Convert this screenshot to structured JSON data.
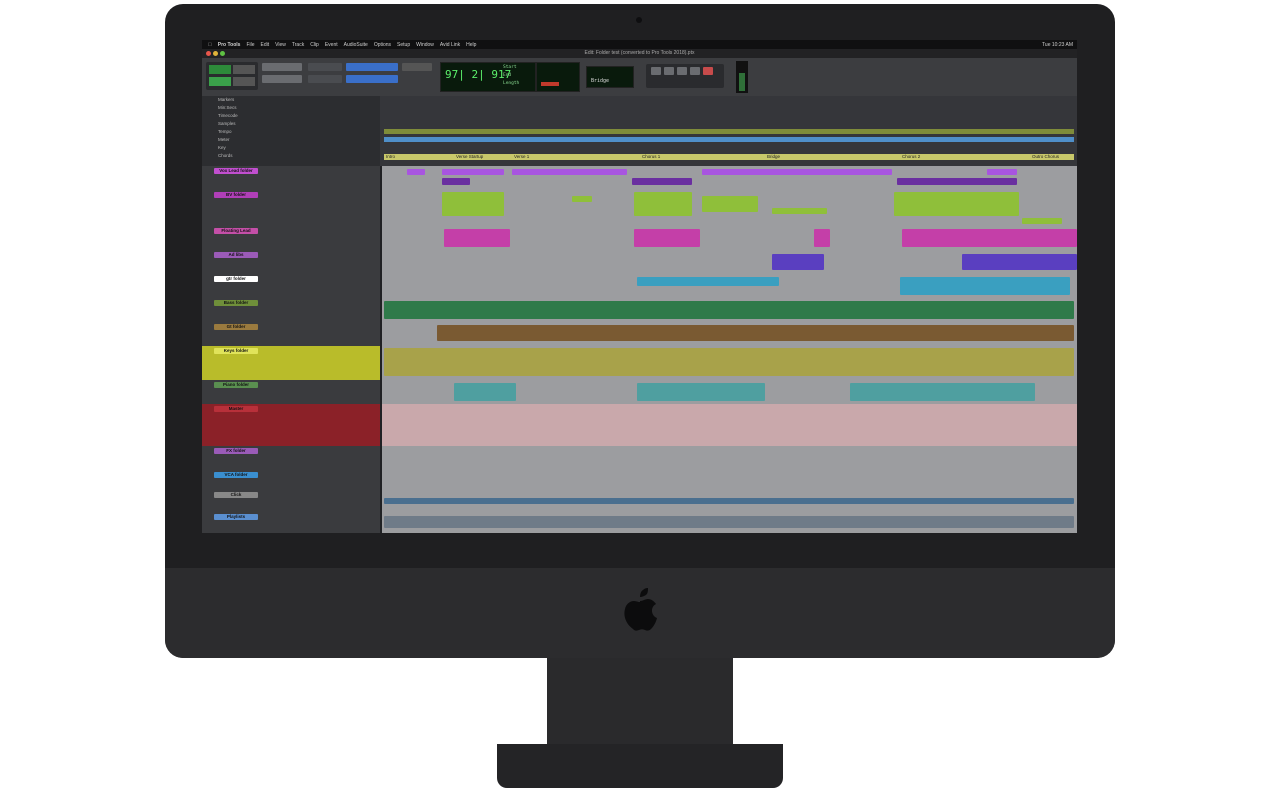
{
  "menubar": {
    "items": [
      "Pro Tools",
      "File",
      "Edit",
      "View",
      "Track",
      "Clip",
      "Event",
      "AudioSuite",
      "Options",
      "Setup",
      "Window",
      "Avid Link",
      "Help"
    ],
    "clock": "Tue 10:23 AM"
  },
  "window": {
    "title": "Edit: Folder test (converted to Pro Tools 2018).ptx"
  },
  "toolbar": {
    "main_counter": "97| 2| 917",
    "sub_counter": "Bridge",
    "start_label": "Start",
    "end_label": "End",
    "length_label": "Length"
  },
  "rulers": [
    "Markers",
    "Min:Secs",
    "Timecode",
    "Samples",
    "Tempo",
    "Meter",
    "Key",
    "Chords"
  ],
  "markers": [
    "Intro",
    "Verse Startup",
    "Verse 1",
    "Chorus 1",
    "Bridge",
    "Chorus 2",
    "Outro Chorus"
  ],
  "tracks": [
    {
      "name": "Vox Lead folder",
      "color": "#c14fcf"
    },
    {
      "name": "BV folder",
      "color": "#b03fb8"
    },
    {
      "name": "Floating Lead",
      "color": "#c44fa8"
    },
    {
      "name": "Ad libs",
      "color": "#9b5bb8"
    },
    {
      "name": "gtr folder",
      "color": "#ffffff"
    },
    {
      "name": "Bass folder",
      "color": "#6f8f3a"
    },
    {
      "name": "Gt folder",
      "color": "#9a7a3e"
    },
    {
      "name": "Keys folder",
      "color": "#c9cc2c"
    },
    {
      "name": "Piano folder",
      "color": "#5a8f50"
    },
    {
      "name": "Master",
      "color": "#b8303a"
    },
    {
      "name": "FX folder",
      "color": "#9a5bb8"
    },
    {
      "name": "VCA folder",
      "color": "#3a8fd0"
    },
    {
      "name": "Click",
      "color": "#888888"
    },
    {
      "name": "Playlists",
      "color": "#5a8fd0"
    }
  ]
}
